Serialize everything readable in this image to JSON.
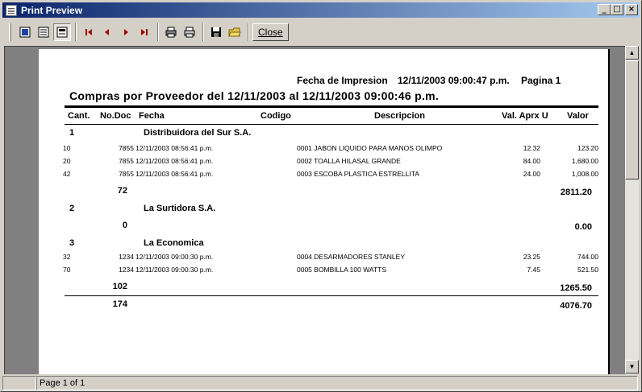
{
  "window": {
    "title": "Print Preview",
    "min": "_",
    "max": "□",
    "close": "×"
  },
  "toolbar": {
    "close_label": "Close"
  },
  "status": {
    "page_info": "Page 1 of 1"
  },
  "report": {
    "print_label": "Fecha de Impresion",
    "print_date": "12/11/2003 09:00:47 p.m.",
    "page_label": "Pagina 1",
    "title": "Compras por Proveedor del 12/11/2003 al 12/11/2003 09:00:46 p.m.",
    "columns": {
      "cant": "Cant.",
      "nodoc": "No.Doc",
      "fecha": "Fecha",
      "codigo": "Codigo",
      "descripcion": "Descripcion",
      "valaprx": "Val. Aprx U",
      "valor": "Valor"
    },
    "groups": [
      {
        "num": "1",
        "name": "Distribuidora del Sur S.A.",
        "rows": [
          {
            "cant": "10",
            "doc": "7855",
            "fecha": "12/11/2003 08:56:41 p.m.",
            "desc": "0001 JABON LIQUIDO PARA MANOS OLIMPO",
            "unit": "12.32",
            "valor": "123.20"
          },
          {
            "cant": "20",
            "doc": "7855",
            "fecha": "12/11/2003 08:56:41 p.m.",
            "desc": "0002 TOALLA HILASAL GRANDE",
            "unit": "84.00",
            "valor": "1,680.00"
          },
          {
            "cant": "42",
            "doc": "7855",
            "fecha": "12/11/2003 08:56:41 p.m.",
            "desc": "0003 ESCOBA PLASTICA ESTRELLITA",
            "unit": "24.00",
            "valor": "1,008.00"
          }
        ],
        "total_cant": "72",
        "total_valor": "2811.20"
      },
      {
        "num": "2",
        "name": "La Surtidora S.A.",
        "rows": [],
        "total_cant": "0",
        "total_valor": "0.00"
      },
      {
        "num": "3",
        "name": "La Economica",
        "rows": [
          {
            "cant": "32",
            "doc": "1234",
            "fecha": "12/11/2003 09:00:30 p.m.",
            "desc": "0004 DESARMADORES STANLEY",
            "unit": "23.25",
            "valor": "744.00"
          },
          {
            "cant": "70",
            "doc": "1234",
            "fecha": "12/11/2003 09:00:30 p.m.",
            "desc": "0005 BOMBILLA 100 WATTS",
            "unit": "7.45",
            "valor": "521.50"
          }
        ],
        "total_cant": "102",
        "total_valor": "1265.50"
      }
    ],
    "grand_total_cant": "174",
    "grand_total_valor": "4076.70"
  }
}
